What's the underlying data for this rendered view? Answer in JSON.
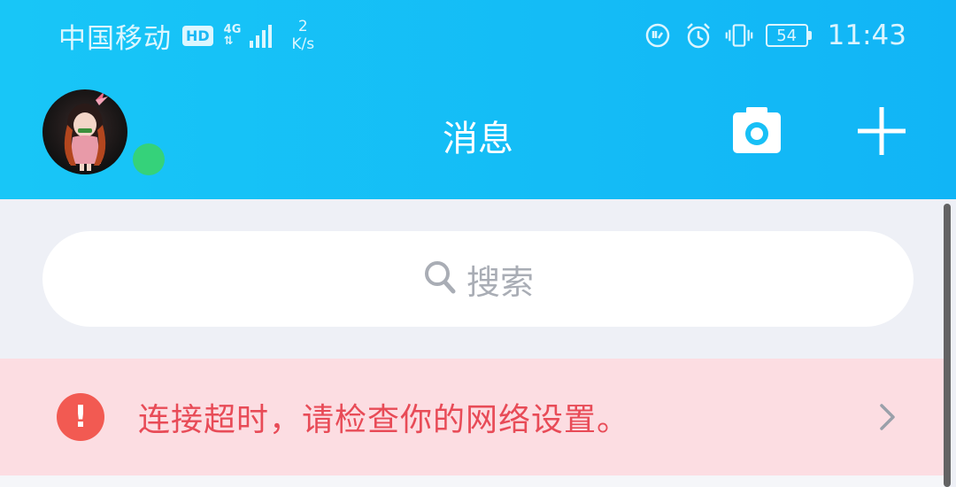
{
  "status_bar": {
    "carrier": "中国移动",
    "hd_badge": "HD",
    "network_type": "4G",
    "speed_value": "2",
    "speed_unit": "K/s",
    "battery_level": "54",
    "time": "11:43"
  },
  "header": {
    "title": "消息"
  },
  "search": {
    "placeholder": "搜索"
  },
  "alert": {
    "message": "连接超时，请检查你的网络设置。"
  },
  "colors": {
    "header": "#18c6f7",
    "online": "#35d27a",
    "alert_bg": "#fcdde2",
    "alert_text": "#e84b57",
    "alert_icon": "#f25a52"
  },
  "icons": {
    "camera": "camera-icon",
    "plus": "plus-icon",
    "search": "search-icon",
    "alert": "exclamation-icon",
    "chevron": "chevron-right-icon"
  }
}
